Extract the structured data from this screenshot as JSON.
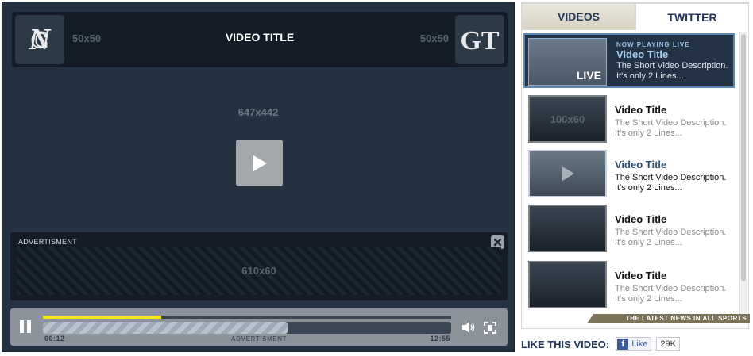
{
  "player": {
    "left_team_size": "50x50",
    "right_team_size": "50x50",
    "title": "VIDEO TITLE",
    "stage_size": "647x442",
    "ad_label": "ADVERTISMENT",
    "ad_size": "610x60",
    "controls": {
      "current_time": "00:12",
      "duration": "12:55",
      "ad_text": "ADVERTISMENT",
      "progress_fraction": 0.29,
      "ad_progress_fraction": 0.6
    },
    "left_team_icon": "unc-logo",
    "right_team_icon": "gt-logo"
  },
  "sidebar": {
    "tabs": [
      {
        "label": "VIDEOS",
        "active": true
      },
      {
        "label": "TWITTER",
        "active": false
      }
    ],
    "items": [
      {
        "now_playing": "NOW PLAYING LIVE",
        "badge": "LIVE",
        "title": "Video Title",
        "desc": "The Short Video Description. It's only 2 Lines...",
        "thumb_text": ""
      },
      {
        "now_playing": "",
        "badge": "",
        "title": "Video Title",
        "desc": "The Short Video Description. It's only 2 Lines...",
        "thumb_text": "100x60"
      },
      {
        "now_playing": "",
        "badge": "",
        "title": "Video Title",
        "desc": "The Short Video Description. It's only 2 Lines...",
        "thumb_text": ""
      },
      {
        "now_playing": "",
        "badge": "",
        "title": "Video Title",
        "desc": "The Short Video Description. It's only 2 Lines...",
        "thumb_text": ""
      },
      {
        "now_playing": "",
        "badge": "",
        "title": "Video Title",
        "desc": "The Short Video Description. It's only 2 Lines...",
        "thumb_text": ""
      }
    ],
    "ribbon": "THE LATEST NEWS IN ALL SPORTS"
  },
  "like": {
    "label": "LIKE THIS VIDEO:",
    "button": "Like",
    "count": "29K"
  },
  "colors": {
    "player_bg": "#233140",
    "accent_yellow": "#f4e61a",
    "brand_navy": "#22365a",
    "live_border": "#5a87b9"
  }
}
